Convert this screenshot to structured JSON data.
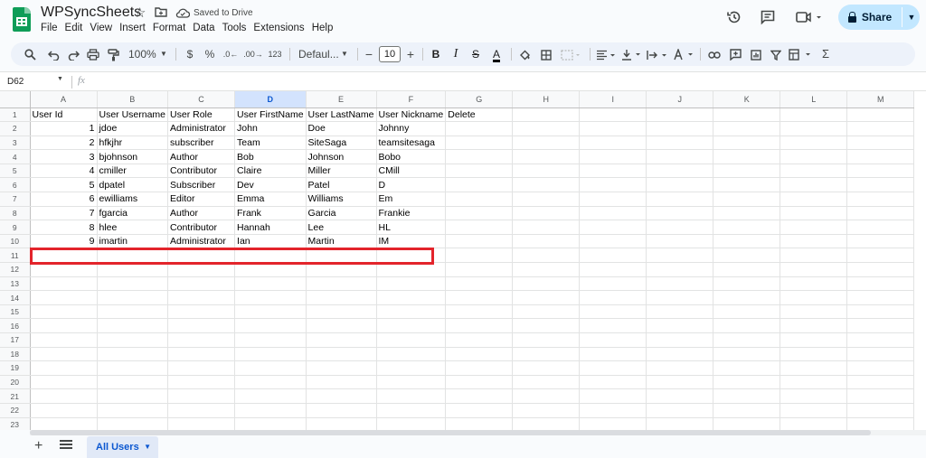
{
  "header": {
    "title": "WPSyncSheets",
    "save_status": "Saved to Drive",
    "share_label": "Share",
    "menu": [
      "File",
      "Edit",
      "View",
      "Insert",
      "Format",
      "Data",
      "Tools",
      "Extensions",
      "Help"
    ]
  },
  "toolbar": {
    "zoom": "100%",
    "currency": "$",
    "percent": "%",
    "decrease_decimal": ".0←",
    "increase_decimal": ".00→",
    "number_format": "123",
    "font": "Defaul...",
    "font_size": "10",
    "bold": "B",
    "italic": "I",
    "strikethrough": "S",
    "text_color": "A",
    "sigma": "Σ"
  },
  "formula_bar": {
    "name_box": "D62",
    "fx": "fx"
  },
  "sheet": {
    "columns": [
      "A",
      "B",
      "C",
      "D",
      "E",
      "F",
      "G",
      "H",
      "I",
      "J",
      "K",
      "L",
      "M"
    ],
    "selected_column": "D",
    "row_numbers": [
      "1",
      "2",
      "3",
      "4",
      "5",
      "6",
      "7",
      "8",
      "9",
      "10",
      "11",
      "12",
      "13",
      "14",
      "15",
      "16",
      "17",
      "18",
      "19",
      "20",
      "21",
      "22",
      "23"
    ],
    "headers": [
      "User Id",
      "User Username",
      "User Role",
      "User FirstName",
      "User LastName",
      "User Nickname",
      "Delete"
    ],
    "rows": [
      [
        "1",
        "jdoe",
        "Administrator",
        "John",
        "Doe",
        "Johnny"
      ],
      [
        "2",
        "hfkjhr",
        "subscriber",
        "Team",
        "SiteSaga",
        "teamsitesaga"
      ],
      [
        "3",
        "bjohnson",
        "Author",
        "Bob",
        "Johnson",
        "Bobo"
      ],
      [
        "4",
        "cmiller",
        "Contributor",
        "Claire",
        "Miller",
        "CMill"
      ],
      [
        "5",
        "dpatel",
        "Subscriber",
        "Dev",
        "Patel",
        "D"
      ],
      [
        "6",
        "ewilliams",
        "Editor",
        "Emma",
        "Williams",
        "Em"
      ],
      [
        "7",
        "fgarcia",
        "Author",
        "Frank",
        "Garcia",
        "Frankie"
      ],
      [
        "8",
        "hlee",
        "Contributor",
        "Hannah",
        "Lee",
        "HL"
      ],
      [
        "9",
        "imartin",
        "Administrator",
        "Ian",
        "Martin",
        "IM"
      ]
    ]
  },
  "sheet_tabs": {
    "active": "All Users"
  },
  "colors": {
    "accent": "#0b57d0",
    "share_bg": "#c2e7ff",
    "highlight_border": "#e3242b",
    "selected_column_bg": "#d3e3fd"
  },
  "icons": [
    "search-icon",
    "undo-icon",
    "redo-icon",
    "print-icon",
    "paint-format-icon",
    "fill-color-icon",
    "borders-icon",
    "merge-icon",
    "align-icon",
    "valign-icon",
    "wrap-icon",
    "rotate-icon",
    "link-icon",
    "comment-icon",
    "chart-icon",
    "filter-icon",
    "filter-views-icon",
    "functions-icon",
    "history-icon",
    "chat-icon",
    "video-icon",
    "star-icon",
    "folder-icon",
    "cloud-icon",
    "lock-icon"
  ]
}
